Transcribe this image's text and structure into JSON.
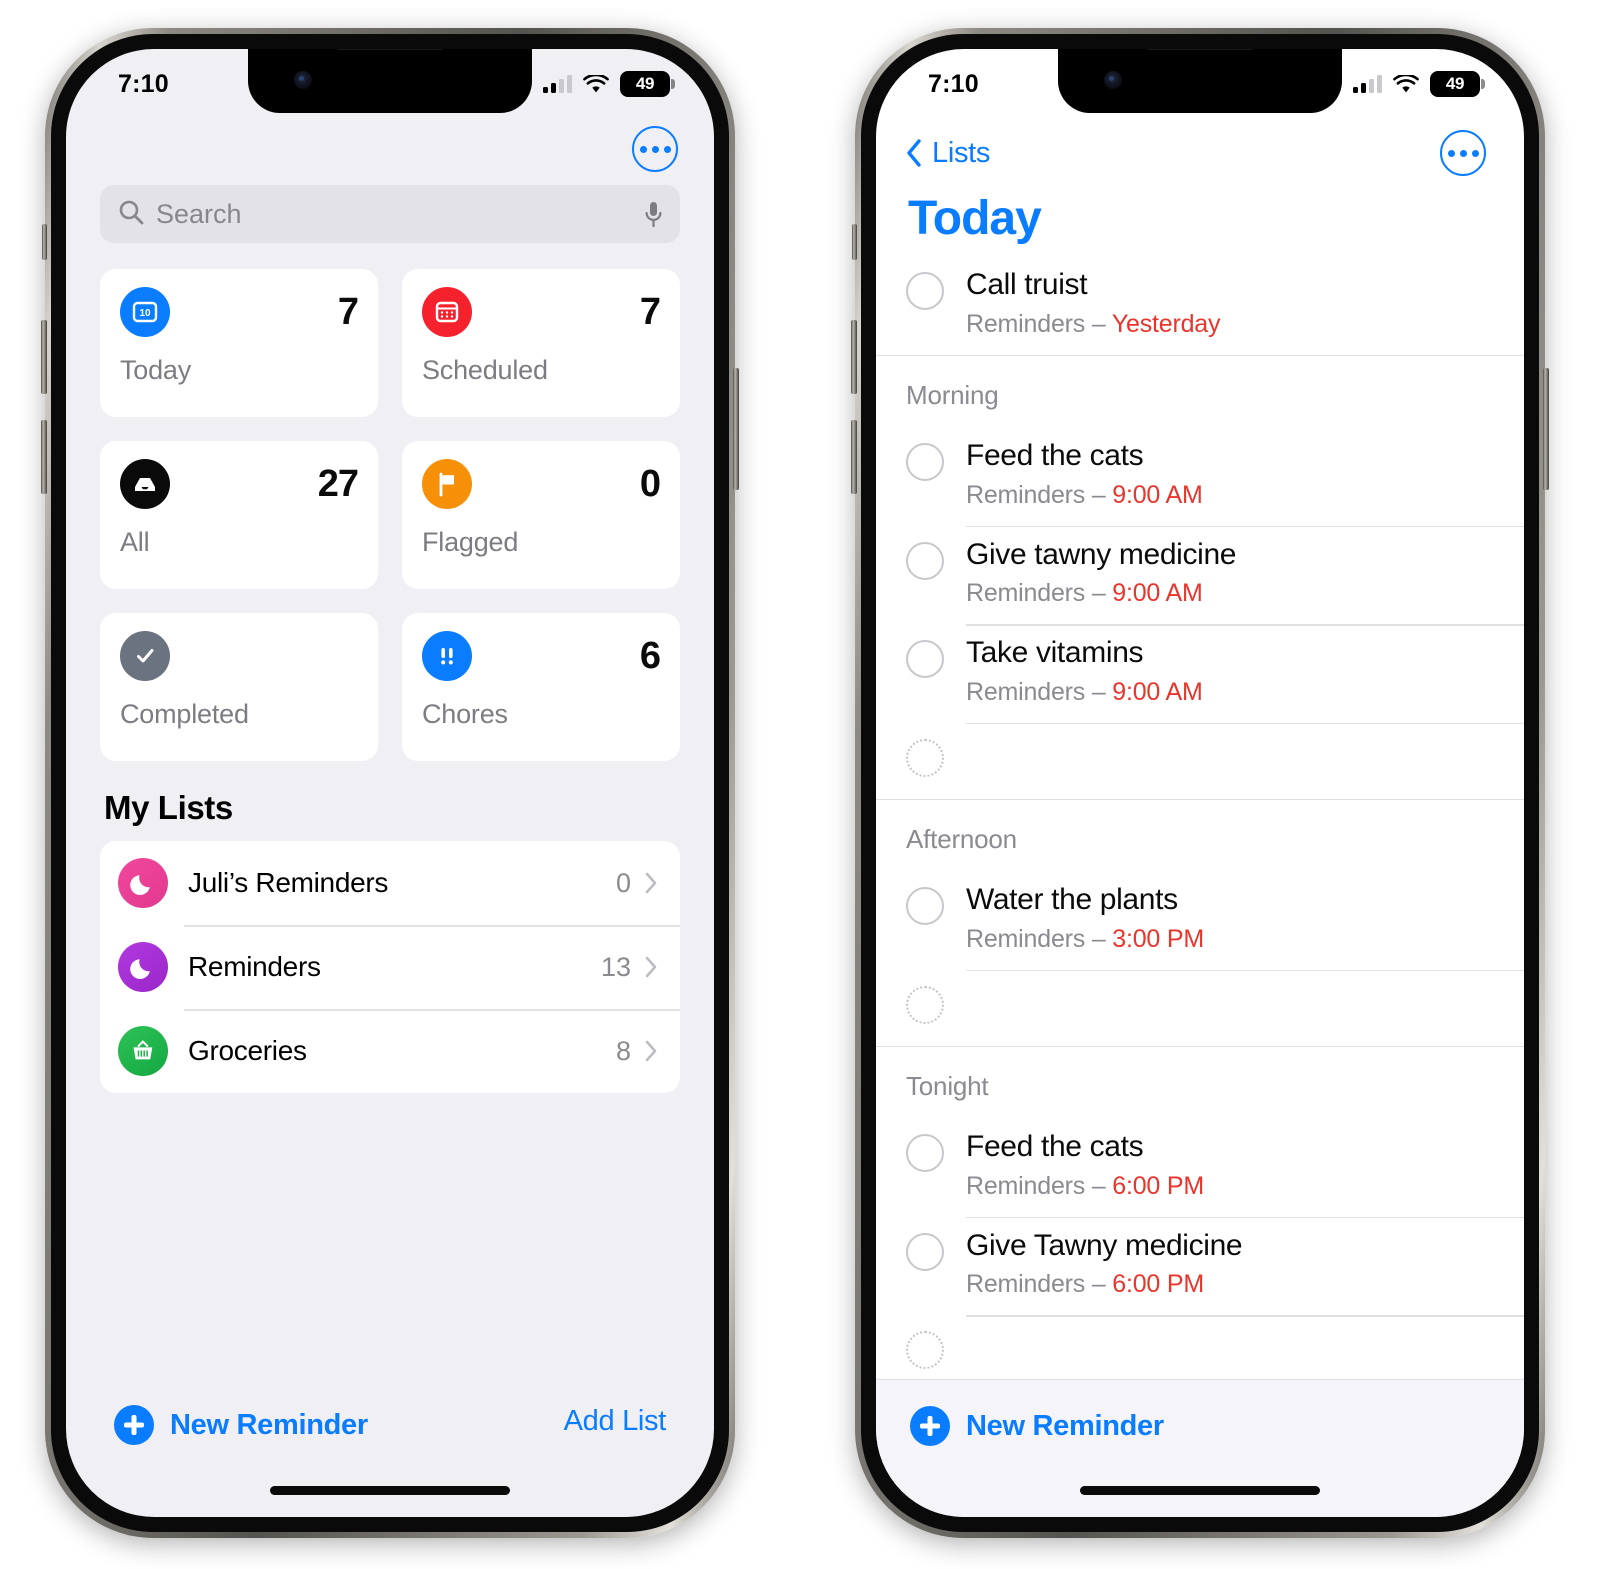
{
  "status_bar": {
    "time": "7:10",
    "battery_level": "49",
    "signal_icon": "cellular-bars-icon",
    "wifi_icon": "wifi-icon",
    "battery_icon": "battery-icon"
  },
  "colors": {
    "accent_blue": "#0a7cff",
    "overdue_red": "#e8362c",
    "grouped_bg": "#f0eff4",
    "card_bg": "#ffffff",
    "secondary_text": "#8b8a90"
  },
  "left_phone": {
    "more_button": "more-options-button",
    "search": {
      "placeholder": "Search",
      "icon": "search-icon",
      "mic_icon": "microphone-icon"
    },
    "smart_lists": [
      {
        "label": "Today",
        "count": "7",
        "icon": "calendar-today-icon",
        "color": "#0a7cff"
      },
      {
        "label": "Scheduled",
        "count": "7",
        "icon": "calendar-icon",
        "color": "#f5222d"
      },
      {
        "label": "All",
        "count": "27",
        "icon": "inbox-tray-icon",
        "color": "#0a0a0a"
      },
      {
        "label": "Flagged",
        "count": "0",
        "icon": "flag-icon",
        "color": "#f79009"
      },
      {
        "label": "Completed",
        "count": "",
        "icon": "checkmark-circle-icon",
        "color": "#6b7280"
      },
      {
        "label": "Chores",
        "count": "6",
        "icon": "exclamation-icon",
        "color": "#0a7cff"
      }
    ],
    "my_lists_header": "My Lists",
    "my_lists": [
      {
        "name": "Juli’s Reminders",
        "count": "0",
        "icon": "moon-icon",
        "color": "#ec4899"
      },
      {
        "name": "Reminders",
        "count": "13",
        "icon": "moon-icon",
        "color": "#a42bd6"
      },
      {
        "name": "Groceries",
        "count": "8",
        "icon": "basket-icon",
        "color": "#22b24c"
      }
    ],
    "footer": {
      "new_reminder": "New Reminder",
      "add_list": "Add List",
      "plus_icon": "plus-circle-icon"
    }
  },
  "right_phone": {
    "back_label": "Lists",
    "back_icon": "chevron-left-icon",
    "more_button": "more-options-button",
    "title": "Today",
    "ungrouped": [
      {
        "title": "Call truist",
        "list": "Reminders – ",
        "time": "Yesterday"
      }
    ],
    "sections": [
      {
        "heading": "Morning",
        "items": [
          {
            "title": "Feed the cats",
            "list": "Reminders – ",
            "time": "9:00 AM"
          },
          {
            "title": "Give tawny medicine",
            "list": "Reminders – ",
            "time": "9:00 AM"
          },
          {
            "title": "Take vitamins",
            "list": "Reminders – ",
            "time": "9:00 AM"
          }
        ]
      },
      {
        "heading": "Afternoon",
        "items": [
          {
            "title": "Water the plants",
            "list": "Reminders – ",
            "time": "3:00 PM"
          }
        ]
      },
      {
        "heading": "Tonight",
        "items": [
          {
            "title": "Feed the cats",
            "list": "Reminders – ",
            "time": "6:00 PM"
          },
          {
            "title": "Give Tawny medicine",
            "list": "Reminders – ",
            "time": "6:00 PM"
          }
        ]
      }
    ],
    "footer": {
      "new_reminder": "New Reminder",
      "plus_icon": "plus-circle-icon"
    }
  }
}
